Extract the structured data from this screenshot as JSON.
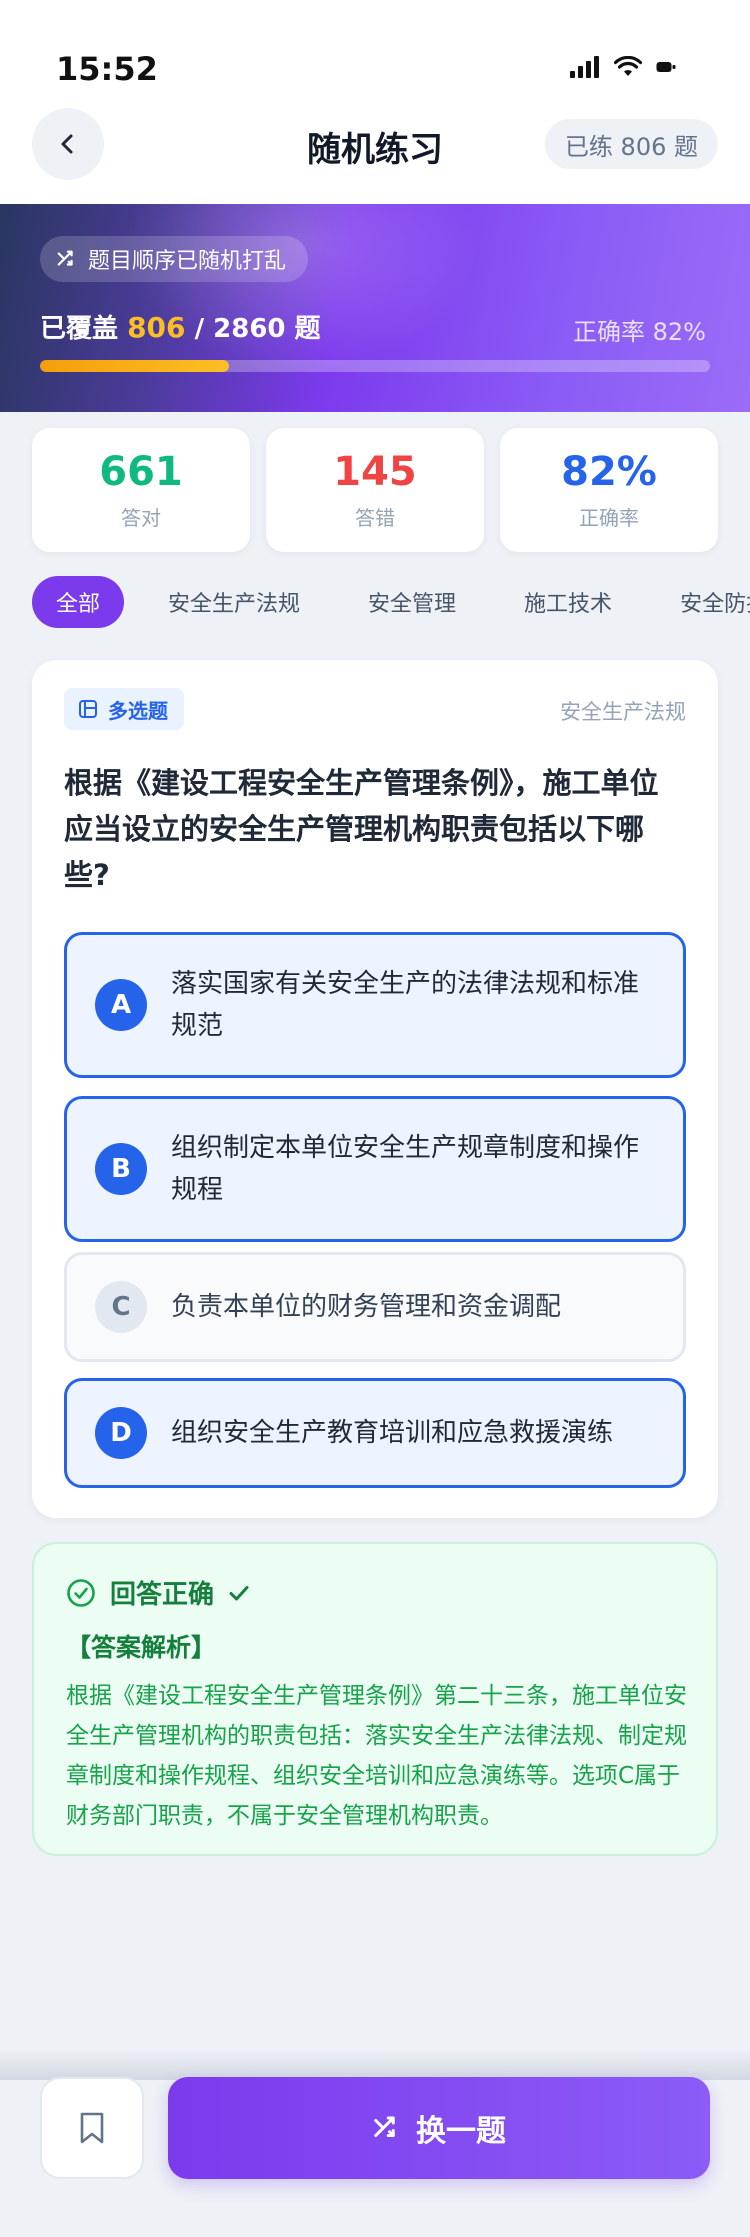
{
  "status": {
    "time": "15:52"
  },
  "header": {
    "title": "随机练习",
    "practiced_badge": "已练 806 题"
  },
  "banner": {
    "shuffle_label": "题目顺序已随机打乱",
    "coverage_prefix": "已覆盖",
    "covered": "806",
    "total": "/ 2860 题",
    "accuracy_label": "正确率 82%",
    "progress_fraction": 0.282
  },
  "stats": [
    {
      "value": "661",
      "label": "答对",
      "color": "#10b981"
    },
    {
      "value": "145",
      "label": "答错",
      "color": "#ef4444"
    },
    {
      "value": "82%",
      "label": "正确率",
      "color": "#2563eb"
    }
  ],
  "categories": [
    "全部",
    "安全生产法规",
    "安全管理",
    "施工技术",
    "安全防护"
  ],
  "active_category": 0,
  "question": {
    "type": "多选题",
    "category": "安全生产法规",
    "text": "根据《建设工程安全生产管理条例》，施工单位应当设立的安全生产管理机构职责包括以下哪些?",
    "options": [
      {
        "letter": "A",
        "text": "落实国家有关安全生产的法律法规和标准规范",
        "selected": true
      },
      {
        "letter": "B",
        "text": "组织制定本单位安全生产规章制度和操作规程",
        "selected": true
      },
      {
        "letter": "C",
        "text": "负责本单位的财务管理和资金调配",
        "selected": false
      },
      {
        "letter": "D",
        "text": "组织安全生产教育培训和应急救援演练",
        "selected": true
      }
    ]
  },
  "analysis": {
    "result": "回答正确",
    "heading": "【答案解析】",
    "text": "根据《建设工程安全生产管理条例》第二十三条，施工单位安全生产管理机构的职责包括：落实安全生产法律法规、制定规章制度和操作规程、组织安全培训和应急演练等。选项C属于财务部门职责，不属于安全管理机构职责。"
  },
  "actions": {
    "next_label": "换一题"
  },
  "colors": {
    "accent": "#7c3aed",
    "primary": "#2563eb",
    "success": "#16a34a"
  }
}
